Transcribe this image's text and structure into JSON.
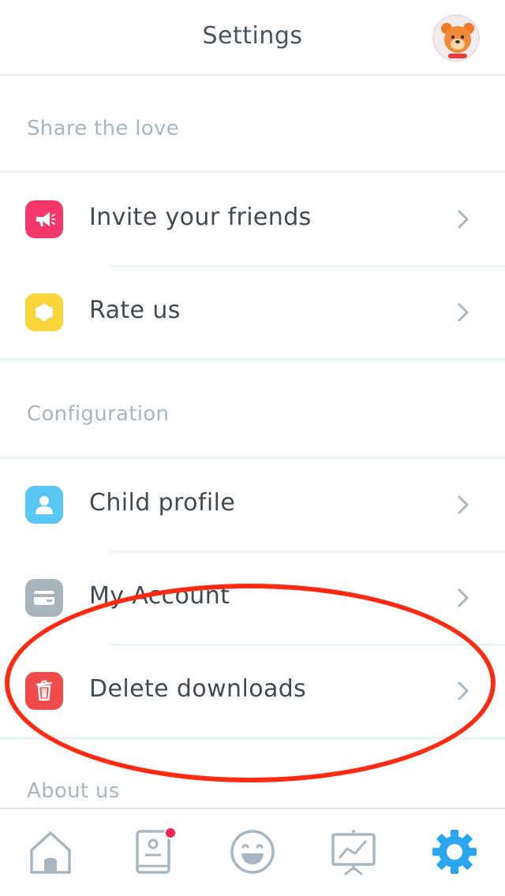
{
  "header": {
    "title": "Settings"
  },
  "sections": {
    "share": {
      "label": "Share the love",
      "items": [
        {
          "label": "Invite your friends",
          "icon": "megaphone-icon",
          "color": "#f5386c"
        },
        {
          "label": "Rate us",
          "icon": "star-icon",
          "color": "#f9d43a"
        }
      ]
    },
    "config": {
      "label": "Configuration",
      "items": [
        {
          "label": "Child profile",
          "icon": "person-icon",
          "color": "#5ac8f5"
        },
        {
          "label": "My Account",
          "icon": "credit-card-icon",
          "color": "#a8b4bc"
        },
        {
          "label": "Delete downloads",
          "icon": "trash-icon",
          "color": "#f24b4b"
        }
      ]
    },
    "about": {
      "label": "About us"
    }
  },
  "bottom_nav": [
    {
      "name": "home-icon",
      "active": false
    },
    {
      "name": "profile-book-icon",
      "active": false,
      "badge": true
    },
    {
      "name": "smiley-icon",
      "active": false
    },
    {
      "name": "stats-board-icon",
      "active": false
    },
    {
      "name": "settings-gear-icon",
      "active": true
    }
  ],
  "colors": {
    "accent": "#2aa6f0",
    "annotation": "#ff2a12",
    "section_label": "#a7b6c0",
    "nav_inactive": "#a7b6c0"
  }
}
